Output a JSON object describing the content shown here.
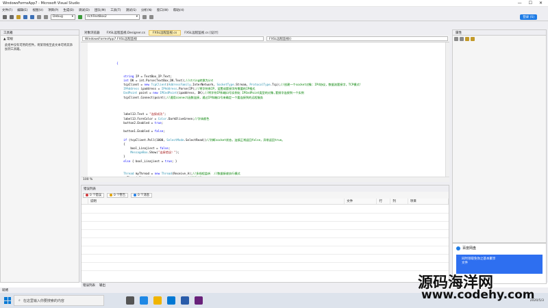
{
  "title": "WindowsFormsApp7 - Microsoft Visual Studio",
  "menu": [
    "文件(F)",
    "编辑(E)",
    "视图(V)",
    "项目(P)",
    "生成(B)",
    "调试(D)",
    "团队(M)",
    "工具(T)",
    "测试(S)",
    "分析(N)",
    "窗口(W)",
    "帮助(H)"
  ],
  "toolbar": {
    "config": "Debug",
    "target": "richTextBox2",
    "signin": "登录 (S)"
  },
  "toolbox": {
    "title": "工具箱",
    "group": "▲ 常规",
    "hint": "此组中没有可用的控件。将某项拖至此文本可将其添加到工具箱。"
  },
  "tabs": [
    {
      "label": "对象浏览器",
      "active": false
    },
    {
      "label": "FXSL远程监视.Designer.cs",
      "active": false
    },
    {
      "label": "FXSL远程监视.cs",
      "active": true
    },
    {
      "label": "FXSL远程监视.cs [设计]",
      "active": false
    }
  ],
  "nav": {
    "left": "WindowsFormsApp7.FXSL远程监视",
    "right": "FXSL远程监视()"
  },
  "code": [
    [
      [
        "k",
        "        {"
      ]
    ],
    [],
    [],
    [
      [
        "k",
        "            "
      ],
      [
        "k",
        "string"
      ],
      [
        "p",
        " IP = TextBox_IP.Text;"
      ]
    ],
    [
      [
        "k",
        "            "
      ],
      [
        "k",
        "int"
      ],
      [
        "p",
        " DK = int.Parse(TextBox_DK.Text);"
      ],
      [
        "c",
        "//string转换为int"
      ]
    ],
    [
      [
        "p",
        "            tcpClient = "
      ],
      [
        "k",
        "new"
      ],
      [
        "p",
        " "
      ],
      [
        "t",
        "TcpClient"
      ],
      [
        "p",
        "("
      ],
      [
        "t",
        "AddressFamily"
      ],
      [
        "p",
        ".InterNetwork, "
      ],
      [
        "t",
        "SocketType"
      ],
      [
        "p",
        ".Stream, "
      ],
      [
        "t",
        "ProtocolType"
      ],
      [
        "p",
        ".Tcp);"
      ],
      [
        "c",
        "//创建一个socket对象：IP4协议，数据流套接字，TCP模式!"
      ]
    ],
    [
      [
        "t",
        "            IPAddress"
      ],
      [
        "p",
        " ipaddress = "
      ],
      [
        "t",
        "IPAddress"
      ],
      [
        "p",
        ".Parse(IP);"
      ],
      [
        "c",
        "//将字符串IP，设置成套接字所需要的IP格式"
      ]
    ],
    [
      [
        "t",
        "            EndPoint"
      ],
      [
        "p",
        " point = "
      ],
      [
        "k",
        "new"
      ],
      [
        "p",
        " "
      ],
      [
        "t",
        "IPEndPoint"
      ],
      [
        "p",
        "(ipaddress, DK);"
      ],
      [
        "c",
        "//将字符IP和端口号实例化 IPEndPoint类型的对象,套接字连接到一个实例"
      ]
    ],
    [
      [
        "p",
        "            tcpClient.Connect(point);"
      ],
      [
        "c",
        "//通用connect函数连接，通过IP和端口号来确定一个要连接到的远程服务"
      ]
    ],
    [],
    [],
    [],
    [
      [
        "p",
        "            label13.Text = "
      ],
      [
        "s",
        "\"连接成功\""
      ],
      [
        "p",
        ";"
      ]
    ],
    [
      [
        "p",
        "            label13.ForeColor = "
      ],
      [
        "t",
        "Color"
      ],
      [
        "p",
        ".DarkOliveGreen;"
      ],
      [
        "c",
        "//字体颜色"
      ]
    ],
    [
      [
        "p",
        "            button2.Enabled = "
      ],
      [
        "k",
        "true"
      ],
      [
        "p",
        ";"
      ]
    ],
    [],
    [
      [
        "p",
        "            button1.Enabled = "
      ],
      [
        "k",
        "false"
      ],
      [
        "p",
        ";"
      ]
    ],
    [],
    [
      [
        "k",
        "            if"
      ],
      [
        "p",
        " (tcpClient.Poll(1000, "
      ],
      [
        "t",
        "SelectMode"
      ],
      [
        "p",
        ".SelectRead))"
      ],
      [
        "c",
        "//判断socket状态，连接正常返回false，异常返回true。"
      ]
    ],
    [
      [
        "p",
        "            {"
      ]
    ],
    [
      [
        "p",
        "                bool_Linajiest = "
      ],
      [
        "k",
        "false"
      ],
      [
        "p",
        ";"
      ]
    ],
    [
      [
        "t",
        "                MessageBox"
      ],
      [
        "p",
        ".Show("
      ],
      [
        "s",
        "\"连接错误！\""
      ],
      [
        "p",
        ");"
      ]
    ],
    [
      [
        "p",
        "            }"
      ]
    ],
    [
      [
        "k",
        "            else"
      ],
      [
        "p",
        " { bool_Linajiest = "
      ],
      [
        "k",
        "true"
      ],
      [
        "p",
        "; }"
      ]
    ],
    [],
    [],
    [
      [
        "t",
        "            Thread"
      ],
      [
        "p",
        " myThread = "
      ],
      [
        "k",
        "new"
      ],
      [
        "p",
        " "
      ],
      [
        "t",
        "Thread"
      ],
      [
        "p",
        "(Receive_A);"
      ],
      [
        "c",
        "//多线程监听  //数据接收执行模式"
      ]
    ],
    [
      [
        "p",
        "            myThread.Start();"
      ],
      [
        "c",
        "                    //线程启动"
      ]
    ]
  ],
  "zoom": "100 %",
  "errors": {
    "title": "错误列表",
    "filters": [
      {
        "label": "0 个错误",
        "color": "#d13438"
      },
      {
        "label": "0 个警告",
        "color": "#e0a000"
      },
      {
        "label": "0 个消息",
        "color": "#1e7ce6"
      }
    ],
    "columns": [
      "说明",
      "文件",
      "行",
      "列",
      "项目"
    ]
  },
  "bottom_tabs": [
    "错误列表",
    "输出"
  ],
  "properties_title": "属性",
  "status": "就绪",
  "taskbar": {
    "search": "在这里输入你要搜索的内容",
    "clock": "2020/5/3"
  },
  "notification": {
    "title": "百度网盘",
    "body": "同时领取免你之基本聚享",
    "sub": "文件"
  },
  "watermark": {
    "line1": "源码海洋网",
    "line2": "www.codehy.com"
  }
}
